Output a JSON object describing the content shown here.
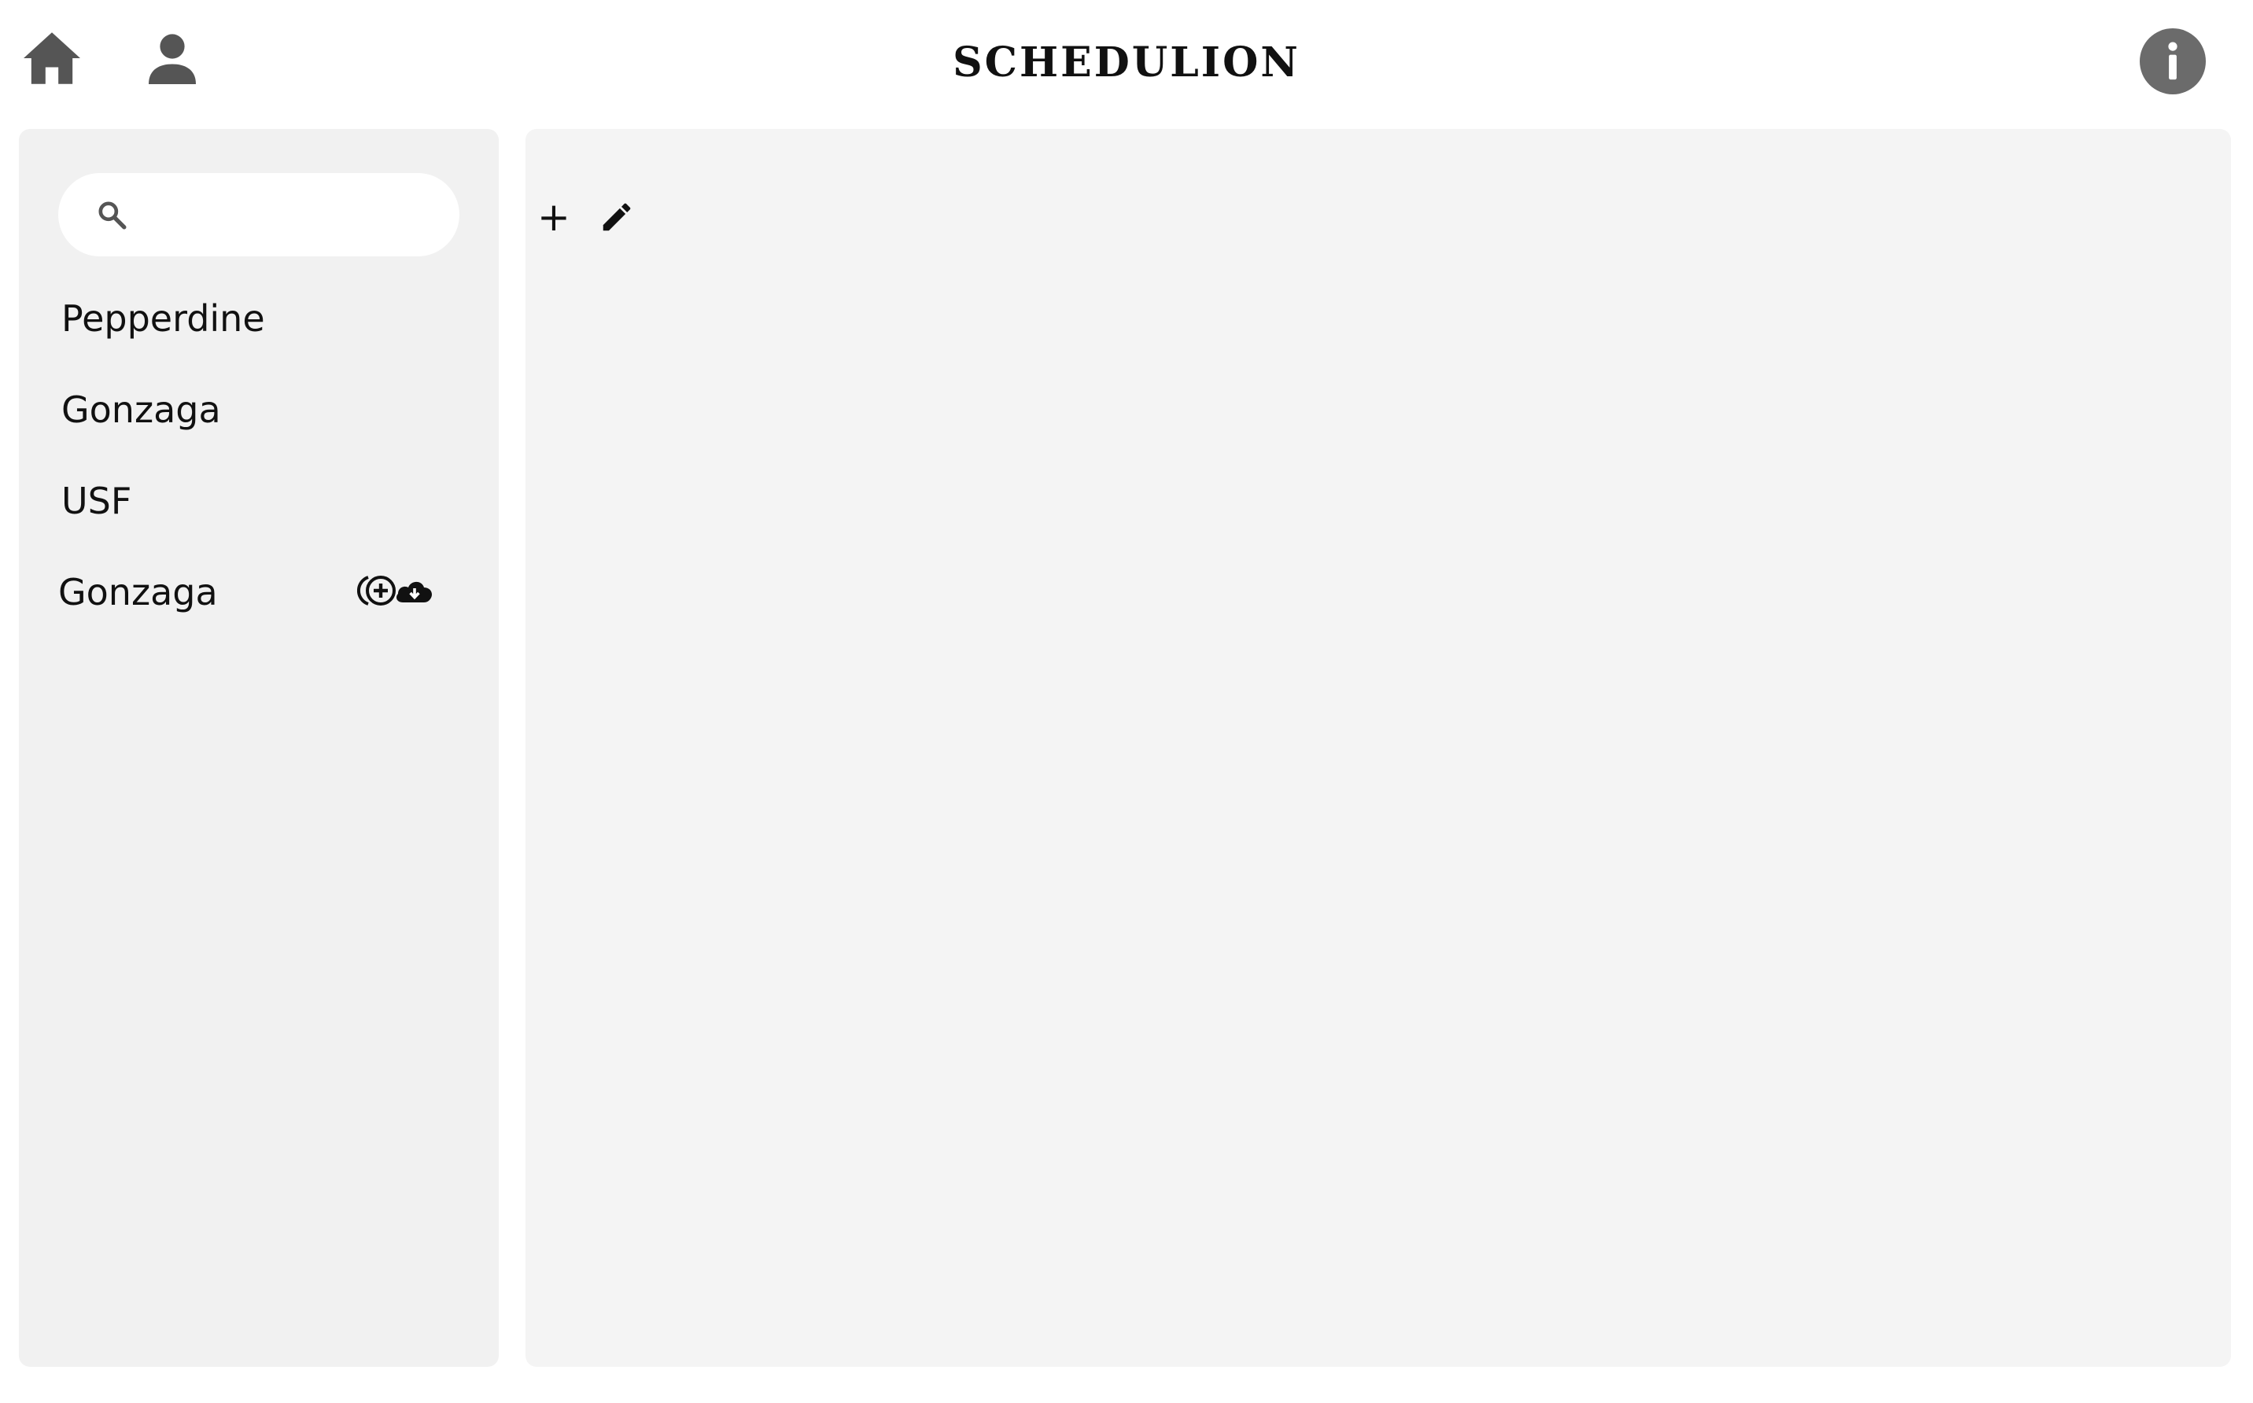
{
  "app": {
    "title": "SCHEDULION"
  },
  "header": {
    "left_icons": [
      "home-icon",
      "user-icon"
    ],
    "right_icons": [
      "info-icon"
    ]
  },
  "sidebar": {
    "search": {
      "value": "",
      "placeholder": "",
      "icon": "search-icon"
    },
    "items": [
      {
        "label": "Pepperdine"
      },
      {
        "label": "Gonzaga"
      },
      {
        "label": "USF"
      },
      {
        "label": "Gonzaga",
        "actions": [
          "add-circle-icon",
          "cloud-download-icon"
        ]
      }
    ]
  },
  "main": {
    "toolbar": {
      "add_label": "+",
      "edit_icon": "pencil-icon"
    }
  },
  "colors": {
    "icon_gray": "#555555",
    "panel_bg": "#f1f1f1",
    "main_bg": "#f4f4f4",
    "info_circle": "#6b6b6b"
  }
}
